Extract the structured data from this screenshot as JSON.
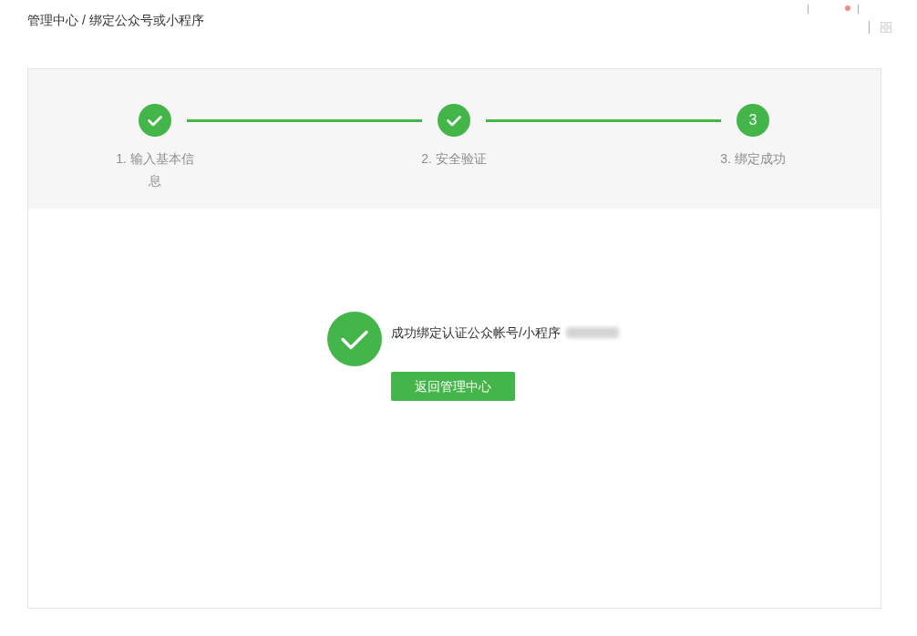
{
  "breadcrumb": "管理中心 / 绑定公众号或小程序",
  "steps": [
    {
      "label": "1. 输入基本信息",
      "completed": true
    },
    {
      "label": "2. 安全验证",
      "completed": true
    },
    {
      "label": "3. 绑定成功",
      "completed": false,
      "number": "3"
    }
  ],
  "result": {
    "message": "成功绑定认证公众帐号/小程序",
    "button": "返回管理中心"
  }
}
